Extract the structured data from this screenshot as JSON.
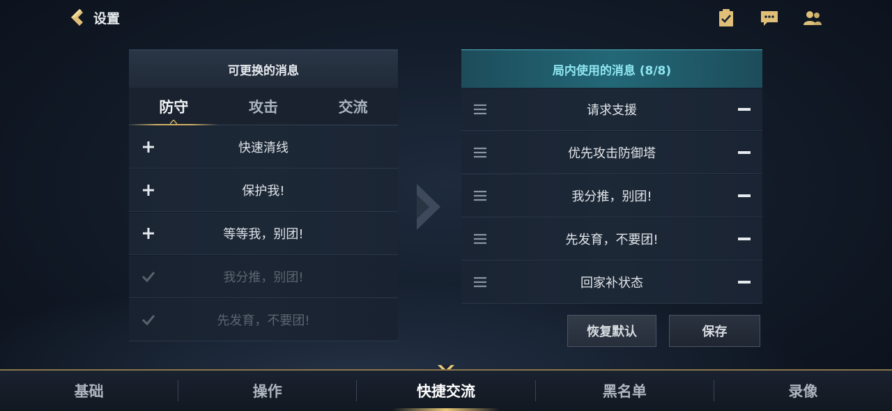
{
  "header": {
    "title": "设置",
    "icons": [
      "back-chevron-icon",
      "clipboard-check-icon",
      "chat-bubble-icon",
      "friends-icon"
    ]
  },
  "left_panel": {
    "title": "可更换的消息",
    "tabs": [
      {
        "label": "防守",
        "active": true
      },
      {
        "label": "攻击",
        "active": false
      },
      {
        "label": "交流",
        "active": false
      }
    ],
    "messages": [
      {
        "text": "快速清线",
        "state": "add"
      },
      {
        "text": "保护我!",
        "state": "add"
      },
      {
        "text": "等等我，别团!",
        "state": "add"
      },
      {
        "text": "我分推，别团!",
        "state": "used"
      },
      {
        "text": "先发育，不要团!",
        "state": "used"
      }
    ]
  },
  "right_panel": {
    "title": "局内使用的消息 (8/8)",
    "messages": [
      {
        "text": "请求支援"
      },
      {
        "text": "优先攻击防御塔"
      },
      {
        "text": "我分推，别团!"
      },
      {
        "text": "先发育，不要团!"
      },
      {
        "text": "回家补状态"
      }
    ],
    "reset_label": "恢复默认",
    "save_label": "保存"
  },
  "bottom_nav": {
    "items": [
      {
        "label": "基础",
        "active": false
      },
      {
        "label": "操作",
        "active": false
      },
      {
        "label": "快捷交流",
        "active": true
      },
      {
        "label": "黑名单",
        "active": false
      },
      {
        "label": "录像",
        "active": false
      }
    ]
  },
  "colors": {
    "gold_accent": "#d2b46a",
    "cyan_header": "#8fe6f0",
    "background": "#131c2a"
  }
}
